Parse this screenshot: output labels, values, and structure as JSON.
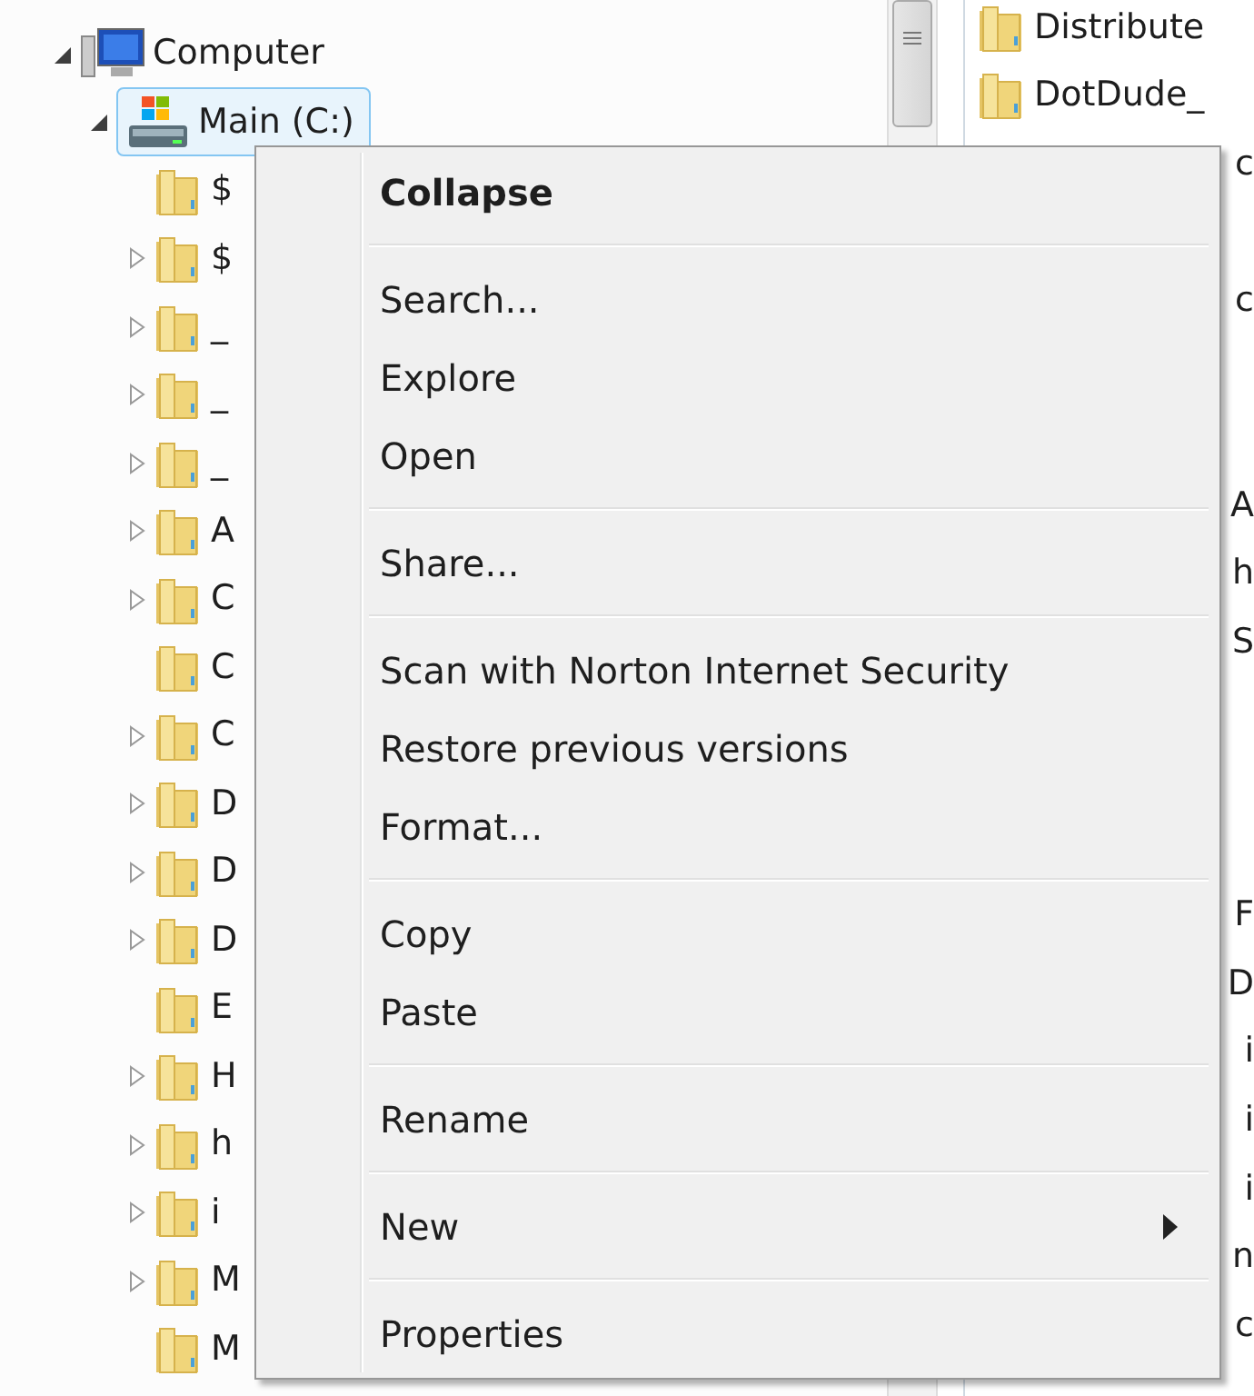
{
  "tree": {
    "items": [
      {
        "label": "Computer",
        "expanded": true,
        "kind": "computer",
        "children": [
          {
            "label": "Main (C:)",
            "expanded": true,
            "selected": true,
            "kind": "drive",
            "children": [
              {
                "label": "$",
                "has_children": false
              },
              {
                "label": "$",
                "has_children": true
              },
              {
                "label": "_",
                "has_children": true
              },
              {
                "label": "_",
                "has_children": true
              },
              {
                "label": "_",
                "has_children": true
              },
              {
                "label": "A",
                "has_children": true
              },
              {
                "label": "C",
                "has_children": true
              },
              {
                "label": "C",
                "has_children": false
              },
              {
                "label": "C",
                "has_children": true
              },
              {
                "label": "D",
                "has_children": true
              },
              {
                "label": "D",
                "has_children": true
              },
              {
                "label": "D",
                "has_children": true
              },
              {
                "label": "E",
                "has_children": false
              },
              {
                "label": "H",
                "has_children": true
              },
              {
                "label": "h",
                "has_children": true
              },
              {
                "label": "i",
                "has_children": true
              },
              {
                "label": "M",
                "has_children": true
              },
              {
                "label": "M",
                "has_children": false
              }
            ]
          }
        ]
      }
    ]
  },
  "file_list": {
    "rows": [
      {
        "kind": "folder",
        "label": "Distribute"
      },
      {
        "kind": "folder",
        "label": "DotDude_"
      },
      {
        "kind": "edge",
        "label": "c"
      },
      {
        "kind": "blank"
      },
      {
        "kind": "edge",
        "label": "c"
      },
      {
        "kind": "blank"
      },
      {
        "kind": "blank"
      },
      {
        "kind": "edge",
        "label": "A"
      },
      {
        "kind": "edge",
        "label": "h"
      },
      {
        "kind": "edge",
        "label": "S"
      },
      {
        "kind": "blank"
      },
      {
        "kind": "blank"
      },
      {
        "kind": "blank"
      },
      {
        "kind": "edge",
        "label": "F"
      },
      {
        "kind": "edge",
        "label": "D"
      },
      {
        "kind": "edge",
        "label": "i"
      },
      {
        "kind": "edge",
        "label": "i"
      },
      {
        "kind": "edge",
        "label": "i"
      },
      {
        "kind": "edge",
        "label": "n"
      },
      {
        "kind": "edge",
        "label": "c"
      }
    ]
  },
  "context_menu": {
    "items": [
      {
        "kind": "item",
        "label": "Collapse",
        "default": true
      },
      {
        "kind": "separator"
      },
      {
        "kind": "item",
        "label": "Search..."
      },
      {
        "kind": "item",
        "label": "Explore"
      },
      {
        "kind": "item",
        "label": "Open"
      },
      {
        "kind": "separator"
      },
      {
        "kind": "item",
        "label": "Share..."
      },
      {
        "kind": "separator"
      },
      {
        "kind": "item",
        "label": "Scan with Norton Internet Security"
      },
      {
        "kind": "item",
        "label": "Restore previous versions"
      },
      {
        "kind": "item",
        "label": "Format..."
      },
      {
        "kind": "separator"
      },
      {
        "kind": "item",
        "label": "Copy"
      },
      {
        "kind": "item",
        "label": "Paste"
      },
      {
        "kind": "separator"
      },
      {
        "kind": "item",
        "label": "Rename"
      },
      {
        "kind": "separator"
      },
      {
        "kind": "item",
        "label": "New",
        "submenu": true
      },
      {
        "kind": "separator"
      },
      {
        "kind": "item",
        "label": "Properties"
      }
    ]
  }
}
